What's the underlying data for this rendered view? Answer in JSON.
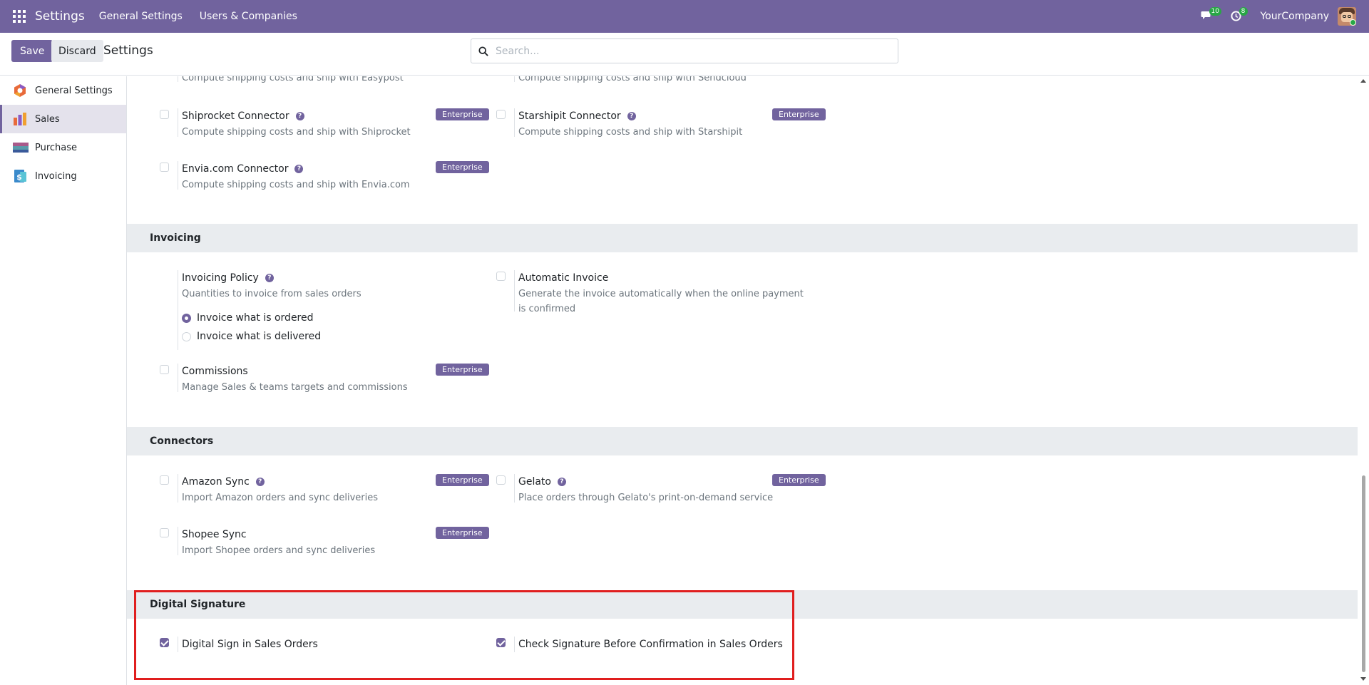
{
  "navbar": {
    "app_title": "Settings",
    "menu": [
      "General Settings",
      "Users & Companies"
    ],
    "messages_count": "10",
    "activities_count": "8",
    "company": "YourCompany"
  },
  "control_panel": {
    "save_label": "Save",
    "discard_label": "Discard",
    "title": "Settings",
    "search_placeholder": "Search..."
  },
  "sidebar": {
    "items": [
      {
        "label": "General Settings",
        "active": false
      },
      {
        "label": "Sales",
        "active": true
      },
      {
        "label": "Purchase",
        "active": false
      },
      {
        "label": "Invoicing",
        "active": false
      }
    ]
  },
  "shipping": {
    "cut_left_desc": "Compute shipping costs and ship with Easypost",
    "cut_right_desc": "Compute shipping costs and ship with Sendcloud",
    "items": [
      {
        "label": "Shiprocket Connector",
        "desc": "Compute shipping costs and ship with Shiprocket",
        "badge": "Enterprise"
      },
      {
        "label": "Starshipit Connector",
        "desc": "Compute shipping costs and ship with Starshipit",
        "badge": "Enterprise"
      },
      {
        "label": "Envia.com Connector",
        "desc": "Compute shipping costs and ship with Envia.com",
        "badge": "Enterprise"
      }
    ]
  },
  "invoicing": {
    "title": "Invoicing",
    "policy": {
      "label": "Invoicing Policy",
      "desc": "Quantities to invoice from sales orders",
      "options": [
        "Invoice what is ordered",
        "Invoice what is delivered"
      ],
      "selected": "Invoice what is ordered"
    },
    "automatic_invoice": {
      "label": "Automatic Invoice",
      "desc": "Generate the invoice automatically when the online payment is confirmed"
    },
    "commissions": {
      "label": "Commissions",
      "desc": "Manage Sales & teams targets and commissions",
      "badge": "Enterprise"
    }
  },
  "connectors": {
    "title": "Connectors",
    "items": [
      {
        "label": "Amazon Sync",
        "desc": "Import Amazon orders and sync deliveries",
        "badge": "Enterprise"
      },
      {
        "label": "Gelato",
        "desc": "Place orders through Gelato's print-on-demand service",
        "badge": "Enterprise"
      },
      {
        "label": "Shopee Sync",
        "desc": "Import Shopee orders and sync deliveries",
        "badge": "Enterprise"
      }
    ]
  },
  "digital_signature": {
    "title": "Digital Signature",
    "items": [
      {
        "label": "Digital Sign in Sales Orders",
        "checked": true
      },
      {
        "label": "Check Signature Before Confirmation in Sales Orders",
        "checked": true
      }
    ]
  },
  "colors": {
    "brand": "#71639e",
    "highlight": "#e01e1e",
    "badge_green": "#28a745"
  },
  "icons": [
    "apps-grid-icon",
    "chat-icon",
    "clock-icon",
    "search-icon",
    "help-icon"
  ]
}
